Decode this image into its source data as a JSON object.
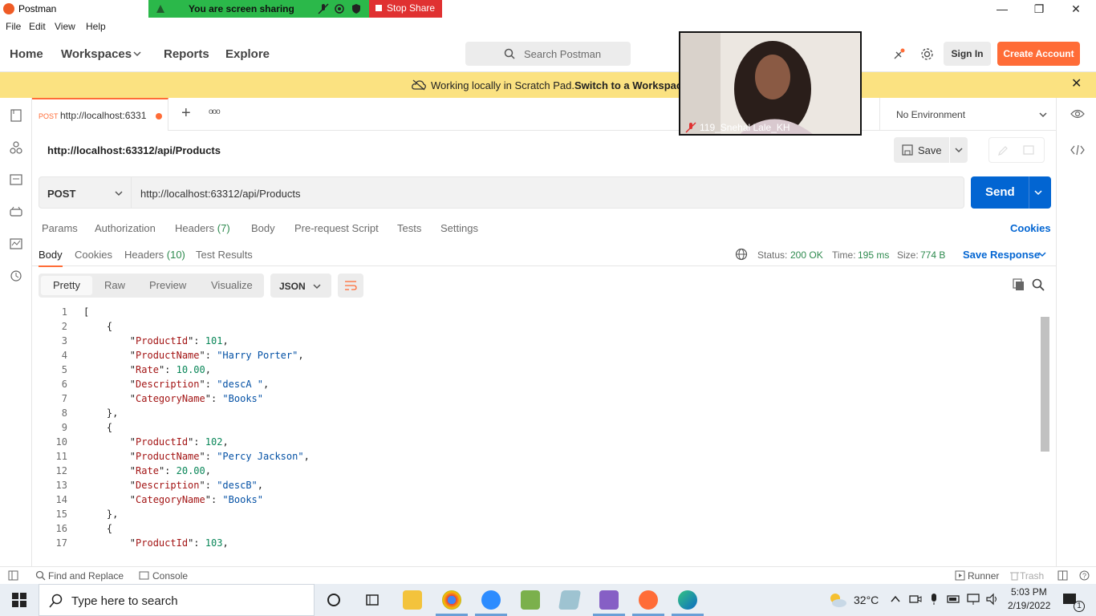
{
  "window": {
    "title": "Postman",
    "minimize": "—",
    "maximize": "❐",
    "close": "✕"
  },
  "share_banner": {
    "text": "You are screen sharing",
    "stop_label": "Stop Share"
  },
  "menu": [
    "File",
    "Edit",
    "View",
    "Help"
  ],
  "header": {
    "nav": [
      "Home",
      "Workspaces",
      "Reports",
      "Explore"
    ],
    "search_placeholder": "Search Postman",
    "sign_in": "Sign In",
    "create_account": "Create Account"
  },
  "scratch_banner": {
    "text": "Working locally in Scratch Pad.",
    "link": "Switch to a Workspace"
  },
  "tab": {
    "method": "POST",
    "title": "http://localhost:6331",
    "add": "+",
    "more": "ooo"
  },
  "environment": {
    "label": "No Environment"
  },
  "request": {
    "title": "http://localhost:63312/api/Products",
    "save_label": "Save",
    "method": "POST",
    "url": "http://localhost:63312/api/Products",
    "send_label": "Send",
    "tabs": [
      "Params",
      "Authorization",
      "Headers",
      "Body",
      "Pre-request Script",
      "Tests",
      "Settings"
    ],
    "headers_count": "(7)",
    "cookies_link": "Cookies"
  },
  "response": {
    "tabs": [
      "Body",
      "Cookies",
      "Headers",
      "Test Results"
    ],
    "headers_count": "(10)",
    "status_label": "Status:",
    "status_value": "200 OK",
    "time_label": "Time:",
    "time_value": "195 ms",
    "size_label": "Size:",
    "size_value": "774 B",
    "save_response": "Save Response",
    "views": [
      "Pretty",
      "Raw",
      "Preview",
      "Visualize"
    ],
    "format": "JSON"
  },
  "code_lines": [
    {
      "n": "1",
      "t": "["
    },
    {
      "n": "2",
      "t": "    {"
    },
    {
      "n": "3",
      "t": "        \"ProductId\": 101,"
    },
    {
      "n": "4",
      "t": "        \"ProductName\": \"Harry Porter\","
    },
    {
      "n": "5",
      "t": "        \"Rate\": 10.00,"
    },
    {
      "n": "6",
      "t": "        \"Description\": \"descA \","
    },
    {
      "n": "7",
      "t": "        \"CategoryName\": \"Books\""
    },
    {
      "n": "8",
      "t": "    },"
    },
    {
      "n": "9",
      "t": "    {"
    },
    {
      "n": "10",
      "t": "        \"ProductId\": 102,"
    },
    {
      "n": "11",
      "t": "        \"ProductName\": \"Percy Jackson\","
    },
    {
      "n": "12",
      "t": "        \"Rate\": 20.00,"
    },
    {
      "n": "13",
      "t": "        \"Description\": \"descB\","
    },
    {
      "n": "14",
      "t": "        \"CategoryName\": \"Books\""
    },
    {
      "n": "15",
      "t": "    },"
    },
    {
      "n": "16",
      "t": "    {"
    },
    {
      "n": "17",
      "t": "        \"ProductId\": 103,"
    }
  ],
  "statusbar": {
    "find_replace": "Find and Replace",
    "console": "Console",
    "runner": "Runner",
    "trash": "Trash"
  },
  "video": {
    "participant": "119_Snehal Lale_KH"
  },
  "taskbar": {
    "search_placeholder": "Type here to search",
    "weather": "32°C",
    "time": "5:03 PM",
    "date": "2/19/2022",
    "notifications": "1"
  },
  "colors": {
    "accent": "#ff6c37",
    "send": "#0265d2",
    "status_ok": "#2d8a4e",
    "banner": "#fbe281"
  }
}
